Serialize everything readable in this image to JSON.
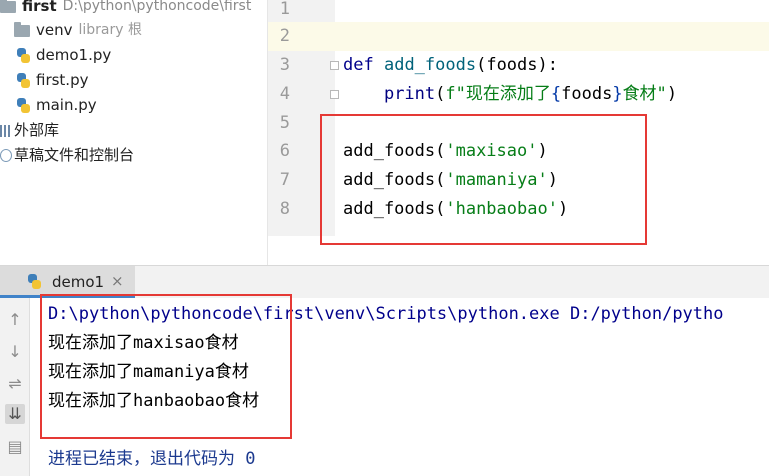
{
  "project_tree": {
    "root": {
      "name": "first",
      "path": "D:\\python\\pythoncode\\first"
    },
    "venv": {
      "name": "venv",
      "hint": "library 根"
    },
    "files": [
      "demo1.py",
      "first.py",
      "main.py"
    ],
    "external_libraries": "外部库",
    "scratches": "草稿文件和控制台"
  },
  "editor": {
    "line_numbers": [
      "1",
      "2",
      "3",
      "4",
      "5",
      "6",
      "7",
      "8"
    ],
    "def_kw": "def",
    "func_name": "add_foods",
    "def_params": "(foods):",
    "print_fn": "print",
    "print_open": "(",
    "f_prefix": "f\"现在添加了",
    "f_brace_open": "{",
    "f_var": "foods",
    "f_brace_close": "}",
    "f_suffix": "食材\"",
    "print_close": ")",
    "calls": [
      {
        "fn": "add_foods(",
        "arg": "'maxisao'",
        "close": ")"
      },
      {
        "fn": "add_foods(",
        "arg": "'mamaniya'",
        "close": ")"
      },
      {
        "fn": "add_foods(",
        "arg": "'hanbaobao'",
        "close": ")"
      }
    ]
  },
  "run_panel": {
    "tab_label": "demo1",
    "tab_close": "×",
    "command": "D:\\python\\pythoncode\\first\\venv\\Scripts\\python.exe D:/python/pytho",
    "output_lines": [
      "现在添加了maxisao食材",
      "现在添加了mamaniya食材",
      "现在添加了hanbaobao食材"
    ],
    "exit_message": "进程已结束，退出代码为 0"
  },
  "colors": {
    "highlight_box": "#e53935",
    "keyword": "#00008b",
    "string": "#067d17",
    "tab_underline": "#4083c9"
  }
}
